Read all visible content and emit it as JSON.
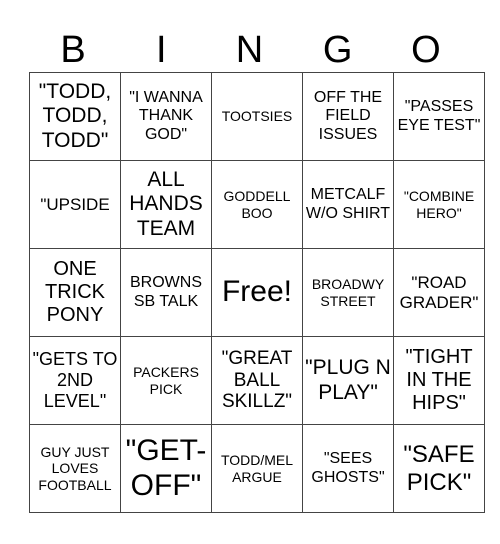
{
  "header": [
    "B",
    "I",
    "N",
    "G",
    "O"
  ],
  "rows": [
    [
      "\"TODD, TODD, TODD\"",
      "\"I WANNA THANK GOD\"",
      "TOOTSIES",
      "OFF THE FIELD ISSUES",
      "\"PASSES EYE TEST\""
    ],
    [
      "\"UPSIDE",
      "ALL HANDS TEAM",
      "GODDELL BOO",
      "METCALF W/O SHIRT",
      "\"COMBINE HERO\""
    ],
    [
      "ONE TRICK PONY",
      "BROWNS SB TALK",
      "Free!",
      "BROADWY STREET",
      "\"ROAD GRADER\""
    ],
    [
      "\"GETS TO 2ND LEVEL\"",
      "PACKERS PICK",
      "\"GREAT BALL SKILLZ\"",
      "\"PLUG N PLAY\"",
      "\"TIGHT IN THE HIPS\""
    ],
    [
      "GUY JUST LOVES FOOTBALL",
      "\"GET-OFF\"",
      "TODD/MEL ARGUE",
      "\"SEES GHOSTS\"",
      "\"SAFE PICK\""
    ]
  ]
}
